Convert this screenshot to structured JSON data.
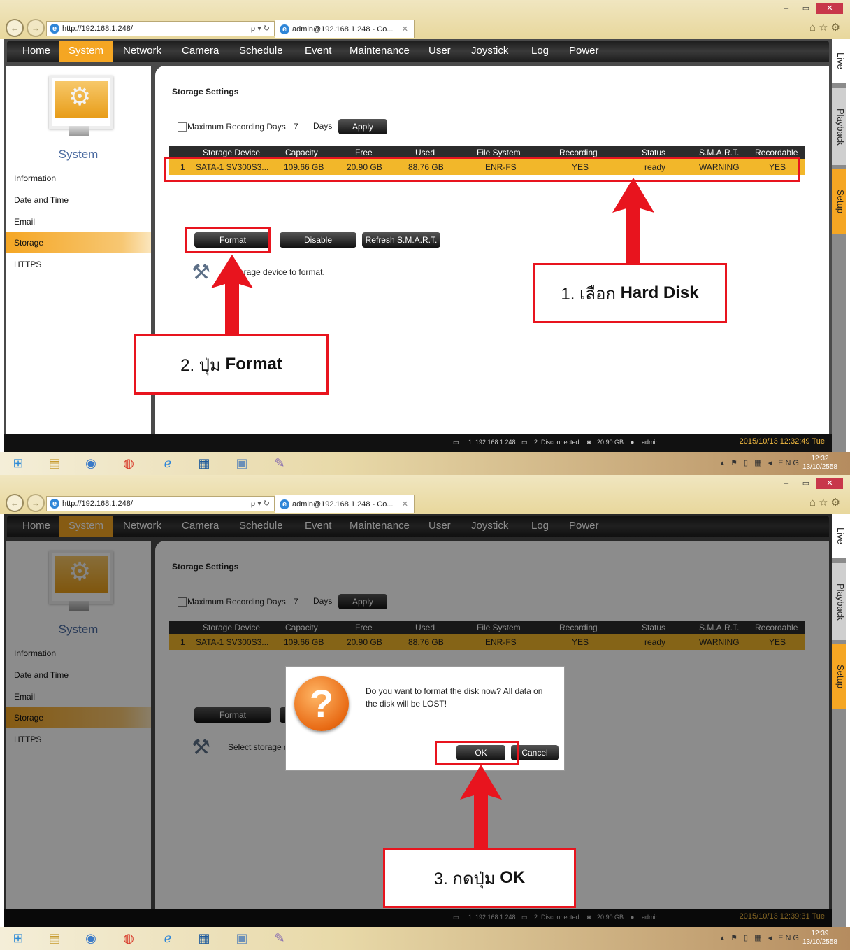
{
  "browser": {
    "url": "http://192.168.1.248/",
    "tab_title": "admin@192.168.1.248 - Co...",
    "address_tools": "ρ ▾ ↻",
    "tab_close": "✕"
  },
  "window_buttons": [
    "–",
    "▭",
    "✕"
  ],
  "menu": [
    "Home",
    "System",
    "Network",
    "Camera",
    "Schedule",
    "Event",
    "Maintenance",
    "User",
    "Joystick",
    "Log",
    "Power"
  ],
  "sidebar": {
    "title": "System",
    "items": [
      "Information",
      "Date and Time",
      "Email",
      "Storage",
      "HTTPS"
    ]
  },
  "right_tabs": [
    "Live",
    "Playback",
    "Setup"
  ],
  "storage": {
    "title": "Storage Settings",
    "max_days_label": "Maximum Recording Days",
    "days_value": "7",
    "days_unit": "Days",
    "apply": "Apply",
    "columns": [
      "Storage Device",
      "Capacity",
      "Free",
      "Used",
      "File System",
      "Recording",
      "Status",
      "S.M.A.R.T.",
      "Recordable"
    ],
    "row": [
      "1",
      "SATA-1 SV300S3...",
      "109.66 GB",
      "20.90 GB",
      "88.76 GB",
      "ENR-FS",
      "YES",
      "ready",
      "WARNING",
      "YES"
    ],
    "buttons": [
      "Format",
      "Disable",
      "Refresh S.M.A.R.T."
    ],
    "message_shot1": "t storage device to format.",
    "message_shot2": "Select storage de"
  },
  "status_bar": {
    "conn1": "1: 192.168.1.248",
    "conn2": "2: Disconnected",
    "disk": "20.90 GB",
    "user": "admin",
    "time_shot1": "2015/10/13 12:32:49 Tue",
    "time_shot2": "2015/10/13 12:39:31 Tue"
  },
  "taskbar": {
    "lang": "ENG",
    "clock1_time": "12:32",
    "clock2_time": "12:39",
    "date": "13/10/2558"
  },
  "dialog": {
    "text": "Do you want to format the disk now? All data on the disk will be LOST!",
    "ok": "OK",
    "cancel": "Cancel"
  },
  "annotations": {
    "step1_num": "1. เลือก",
    "step1_bold": "Hard Disk",
    "step2_num": "2. ปุ่ม",
    "step2_bold": "Format",
    "step3_num": "3. กดปุ่ม",
    "step3_bold": "OK"
  },
  "colors": {
    "accent": "#f5a623",
    "annotation_red": "#e8141e",
    "row_highlight": "#f2b72a"
  }
}
